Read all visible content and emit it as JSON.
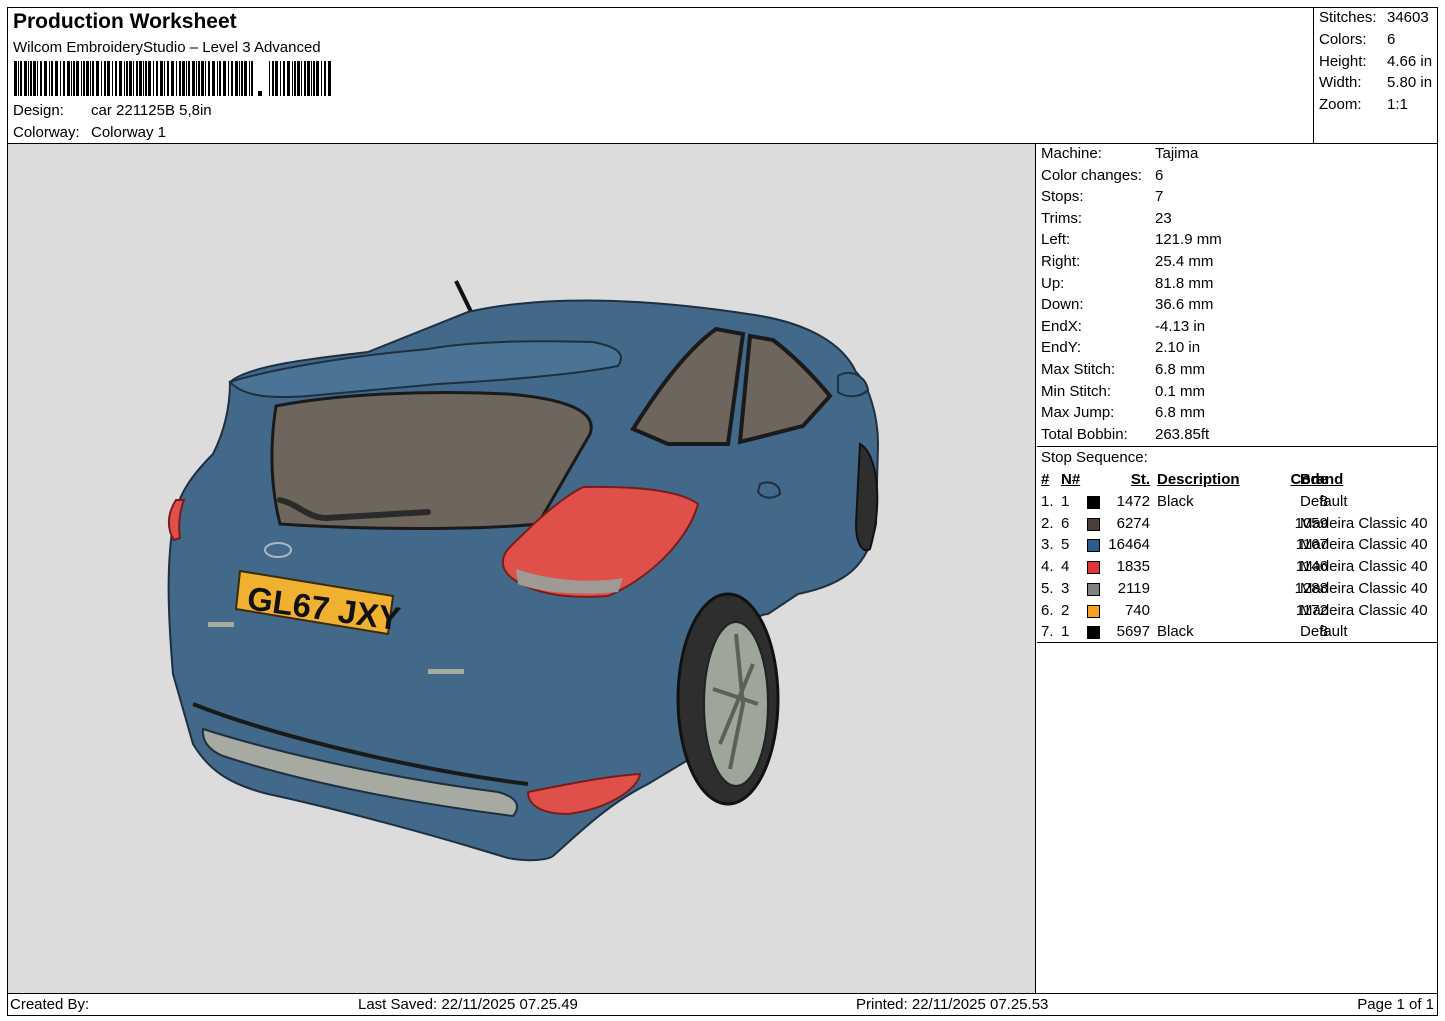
{
  "header": {
    "title": "Production Worksheet",
    "software": "Wilcom EmbroideryStudio – Level 3 Advanced",
    "design_label": "Design:",
    "design_value": "car 221125B 5,8in",
    "colorway_label": "Colorway:",
    "colorway_value": "Colorway 1"
  },
  "stats": [
    {
      "label": "Stitches:",
      "value": "34603"
    },
    {
      "label": "Colors:",
      "value": "6"
    },
    {
      "label": "Height:",
      "value": "4.66 in"
    },
    {
      "label": "Width:",
      "value": "5.80 in"
    },
    {
      "label": "Zoom:",
      "value": "1:1"
    }
  ],
  "machine_info": [
    {
      "label": "Machine:",
      "value": "Tajima"
    },
    {
      "label": "Color changes:",
      "value": "6"
    },
    {
      "label": "Stops:",
      "value": "7"
    },
    {
      "label": "Trims:",
      "value": "23"
    },
    {
      "label": "Left:",
      "value": "121.9 mm"
    },
    {
      "label": "Right:",
      "value": "25.4 mm"
    },
    {
      "label": "Up:",
      "value": "81.8 mm"
    },
    {
      "label": "Down:",
      "value": "36.6 mm"
    },
    {
      "label": "EndX:",
      "value": "-4.13 in"
    },
    {
      "label": "EndY:",
      "value": "2.10 in"
    },
    {
      "label": "Max Stitch:",
      "value": "6.8 mm"
    },
    {
      "label": "Min Stitch:",
      "value": "0.1 mm"
    },
    {
      "label": "Max Jump:",
      "value": "6.8 mm"
    },
    {
      "label": "Total Bobbin:",
      "value": "263.85ft"
    }
  ],
  "stop_sequence": {
    "title": "Stop Sequence:",
    "headers": {
      "idx": "#",
      "n": "N#",
      "st": "St.",
      "desc": "Description",
      "code": "Code",
      "brand": "Brand"
    },
    "rows": [
      {
        "idx": "1.",
        "n": "1",
        "color": "#000000",
        "st": "1472",
        "desc": "Black",
        "code": "8",
        "brand": "Default"
      },
      {
        "idx": "2.",
        "n": "6",
        "color": "#4a3f3a",
        "st": "6274",
        "desc": "",
        "code": "1059",
        "brand": "Madeira Classic 40"
      },
      {
        "idx": "3.",
        "n": "5",
        "color": "#2d5b8c",
        "st": "16464",
        "desc": "",
        "code": "1167",
        "brand": "Madeira Classic 40"
      },
      {
        "idx": "4.",
        "n": "4",
        "color": "#e03535",
        "st": "1835",
        "desc": "",
        "code": "1146",
        "brand": "Madeira Classic 40"
      },
      {
        "idx": "5.",
        "n": "3",
        "color": "#808080",
        "st": "2119",
        "desc": "",
        "code": "1288",
        "brand": "Madeira Classic 40"
      },
      {
        "idx": "6.",
        "n": "2",
        "color": "#f5a020",
        "st": "740",
        "desc": "",
        "code": "1172",
        "brand": "Madeira Classic 40"
      },
      {
        "idx": "7.",
        "n": "1",
        "color": "#000000",
        "st": "5697",
        "desc": "Black",
        "code": "8",
        "brand": "Default"
      }
    ]
  },
  "design_preview": {
    "plate_text": "GL67 JXY",
    "body_color": "#42698a",
    "window_color": "#6e655c",
    "light_color": "#e0504a",
    "plate_color": "#f0b030"
  },
  "footer": {
    "created_by": "Created By:",
    "last_saved": "Last Saved: 22/11/2025 07.25.49",
    "printed": "Printed: 22/11/2025 07.25.53",
    "page": "Page 1 of 1"
  }
}
